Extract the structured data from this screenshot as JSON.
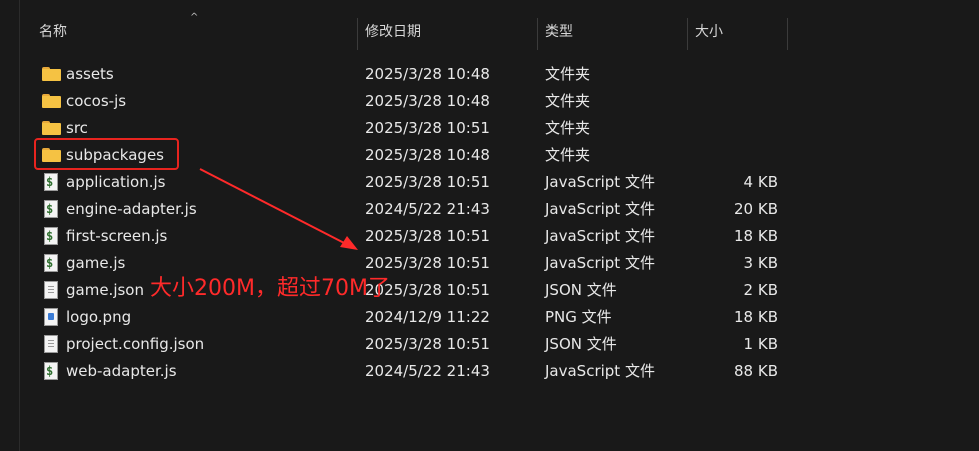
{
  "columns": {
    "name": "名称",
    "date": "修改日期",
    "type": "类型",
    "size": "大小"
  },
  "files": [
    {
      "name": "assets",
      "date": "2025/3/28 10:48",
      "type": "文件夹",
      "size": "",
      "icon": "folder-icon"
    },
    {
      "name": "cocos-js",
      "date": "2025/3/28 10:48",
      "type": "文件夹",
      "size": "",
      "icon": "folder-icon"
    },
    {
      "name": "src",
      "date": "2025/3/28 10:51",
      "type": "文件夹",
      "size": "",
      "icon": "folder-icon"
    },
    {
      "name": "subpackages",
      "date": "2025/3/28 10:48",
      "type": "文件夹",
      "size": "",
      "icon": "folder-icon"
    },
    {
      "name": "application.js",
      "date": "2025/3/28 10:51",
      "type": "JavaScript 文件",
      "size": "4 KB",
      "icon": "js-file-icon"
    },
    {
      "name": "engine-adapter.js",
      "date": "2024/5/22 21:43",
      "type": "JavaScript 文件",
      "size": "20 KB",
      "icon": "js-file-icon"
    },
    {
      "name": "first-screen.js",
      "date": "2025/3/28 10:51",
      "type": "JavaScript 文件",
      "size": "18 KB",
      "icon": "js-file-icon"
    },
    {
      "name": "game.js",
      "date": "2025/3/28 10:51",
      "type": "JavaScript 文件",
      "size": "3 KB",
      "icon": "js-file-icon"
    },
    {
      "name": "game.json",
      "date": "2025/3/28 10:51",
      "type": "JSON 文件",
      "size": "2 KB",
      "icon": "json-file-icon"
    },
    {
      "name": "logo.png",
      "date": "2024/12/9 11:22",
      "type": "PNG 文件",
      "size": "18 KB",
      "icon": "png-file-icon"
    },
    {
      "name": "project.config.json",
      "date": "2025/3/28 10:51",
      "type": "JSON 文件",
      "size": "1 KB",
      "icon": "json-file-icon"
    },
    {
      "name": "web-adapter.js",
      "date": "2024/5/22 21:43",
      "type": "JavaScript 文件",
      "size": "88 KB",
      "icon": "js-file-icon"
    }
  ],
  "annotation": {
    "text": "大小200M，超过70M了",
    "color": "#ff2a2a"
  },
  "colors": {
    "background": "#191919",
    "highlight": "#e8241f",
    "folder": "#f5c243"
  }
}
